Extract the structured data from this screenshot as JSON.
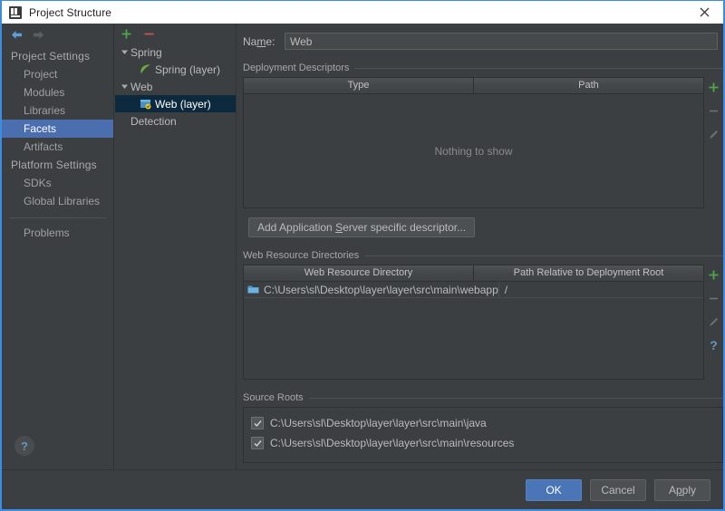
{
  "window": {
    "title": "Project Structure",
    "icon": "project-structure-icon",
    "close_label": "✕"
  },
  "sidebar": {
    "nav": {
      "back_icon": "arrow-left-icon",
      "forward_icon": "arrow-right-icon"
    },
    "groups": [
      {
        "label": "Project Settings",
        "items": [
          {
            "label": "Project",
            "selected": false
          },
          {
            "label": "Modules",
            "selected": false
          },
          {
            "label": "Libraries",
            "selected": false
          },
          {
            "label": "Facets",
            "selected": true
          },
          {
            "label": "Artifacts",
            "selected": false
          }
        ]
      },
      {
        "label": "Platform Settings",
        "items": [
          {
            "label": "SDKs",
            "selected": false
          },
          {
            "label": "Global Libraries",
            "selected": false
          }
        ]
      }
    ],
    "problems_label": "Problems",
    "help_button": "?"
  },
  "tree": {
    "toolbar": {
      "add_icon": "plus-icon",
      "remove_icon": "minus-icon"
    },
    "nodes": [
      {
        "label": "Spring",
        "level": 0,
        "expanded": true,
        "icon": null,
        "selected": false
      },
      {
        "label": "Spring (layer)",
        "level": 1,
        "expanded": null,
        "icon": "spring-leaf-icon",
        "selected": false
      },
      {
        "label": "Web",
        "level": 0,
        "expanded": true,
        "icon": null,
        "selected": false
      },
      {
        "label": "Web (layer)",
        "level": 1,
        "expanded": null,
        "icon": "web-facet-icon",
        "selected": true
      },
      {
        "label": "Detection",
        "level": 0,
        "expanded": null,
        "icon": null,
        "selected": false
      }
    ]
  },
  "main": {
    "name_field": {
      "label_pre": "Na",
      "label_mnemonic": "m",
      "label_post": "e:",
      "value": "Web"
    },
    "deployment_descriptors": {
      "title": "Deployment Descriptors",
      "columns": [
        "Type",
        "Path"
      ],
      "rows": [],
      "empty_text": "Nothing to show",
      "toolbar": [
        {
          "name": "add-descriptor-button",
          "icon": "plus-icon",
          "enabled": true
        },
        {
          "name": "remove-descriptor-button",
          "icon": "minus-icon",
          "enabled": false
        },
        {
          "name": "edit-descriptor-button",
          "icon": "pencil-icon",
          "enabled": false
        }
      ]
    },
    "add_descriptor_button": {
      "pre": "Add Application ",
      "mnemonic": "S",
      "post": "erver specific descriptor..."
    },
    "web_resource_directories": {
      "title": "Web Resource Directories",
      "columns": [
        "Web Resource Directory",
        "Path Relative to Deployment Root"
      ],
      "rows": [
        {
          "directory": "C:\\Users\\sl\\Desktop\\layer\\layer\\src\\main\\webapp",
          "relative_path": "/",
          "icon": "folder-icon"
        }
      ],
      "toolbar": [
        {
          "name": "add-web-resource-button",
          "icon": "plus-icon",
          "enabled": true
        },
        {
          "name": "remove-web-resource-button",
          "icon": "minus-icon",
          "enabled": false
        },
        {
          "name": "edit-web-resource-button",
          "icon": "pencil-icon",
          "enabled": false
        },
        {
          "name": "help-web-resource-button",
          "icon": "question-icon",
          "enabled": true
        }
      ]
    },
    "source_roots": {
      "title": "Source Roots",
      "items": [
        {
          "label": "C:\\Users\\sl\\Desktop\\layer\\layer\\src\\main\\java",
          "checked": true
        },
        {
          "label": "C:\\Users\\sl\\Desktop\\layer\\layer\\src\\main\\resources",
          "checked": true
        }
      ]
    }
  },
  "footer": {
    "ok": "OK",
    "cancel": "Cancel",
    "apply_pre": "A",
    "apply_mnemonic": "p",
    "apply_post": "ply"
  },
  "colors": {
    "accent_selection": "#4b6eaf",
    "tree_selection": "#0d293e",
    "primary_button": "#4a76b8",
    "panel_bg": "#3c3f41",
    "window_border": "#3c8ce0",
    "add_icon": "#4ba84b",
    "remove_icon": "#c75450",
    "help_blue": "#6897bb"
  }
}
